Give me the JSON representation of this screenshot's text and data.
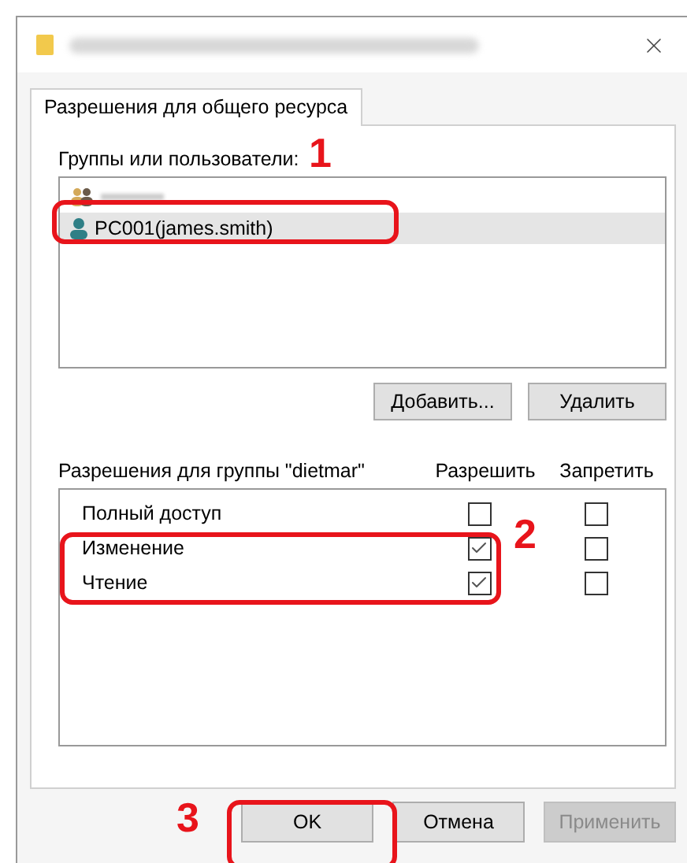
{
  "tabs": [
    {
      "label": "Разрешения для общего ресурса",
      "selected": true
    }
  ],
  "groups": {
    "label": "Группы или пользователи:",
    "items": [
      {
        "kind": "group",
        "selected": false
      },
      {
        "label": "PC001(james.smith)",
        "kind": "user",
        "selected": true
      }
    ],
    "buttons": [
      {
        "label": "Добавить..."
      },
      {
        "label": "Удалить"
      }
    ]
  },
  "permissions": {
    "label": "Разрешения для группы \"dietmar\"",
    "columns": [
      "Разрешить",
      "Запретить"
    ],
    "rows": [
      {
        "label": "Полный доступ",
        "allow": false,
        "deny": false
      },
      {
        "label": "Изменение",
        "allow": true,
        "deny": false
      },
      {
        "label": "Чтение",
        "allow": true,
        "deny": false
      }
    ]
  },
  "buttons": [
    {
      "label": "OK",
      "disabled": false
    },
    {
      "label": "Отмена",
      "disabled": false
    },
    {
      "label": "Применить",
      "disabled": true
    }
  ],
  "annotations": [
    {
      "label": "1"
    },
    {
      "label": "2"
    },
    {
      "label": "3"
    }
  ]
}
